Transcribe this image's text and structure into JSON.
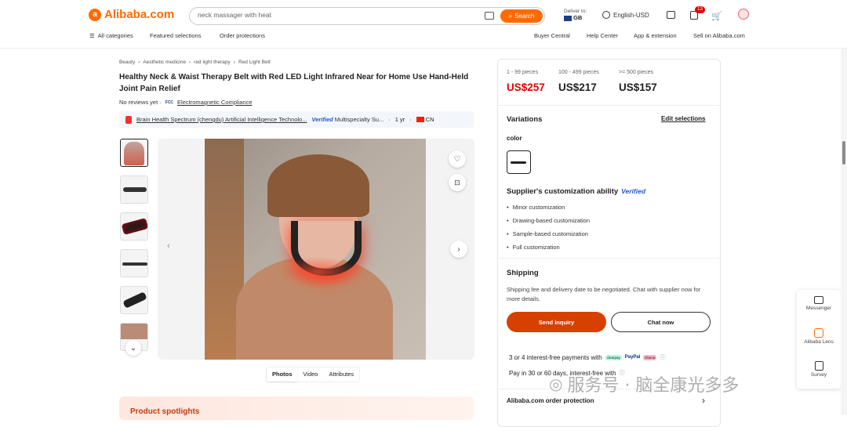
{
  "header": {
    "logo": "Alibaba.com",
    "search_value": "neck massager with heat",
    "search_button": "Search",
    "deliver_to_label": "Deliver to:",
    "deliver_to_country": "GB",
    "language": "English-USD",
    "cart_badge": "13",
    "nav_left": [
      "All categories",
      "Featured selections",
      "Order protections"
    ],
    "nav_right": [
      "Buyer Central",
      "Help Center",
      "App & extension",
      "Sell on Alibaba.com"
    ]
  },
  "breadcrumb": [
    "Beauty",
    "Aesthetic medicine",
    "red light therapy",
    "Red Light Belt"
  ],
  "product": {
    "title": "Healthy Neck & Waist Therapy Belt with Red LED Light Infrared Near for Home Use Hand-Held Joint Pain Relief",
    "reviews": "No reviews yet ·",
    "fcc_badge": "FCC",
    "compliance": "Electromagnetic Compliance"
  },
  "supplier": {
    "name": "Brain Health Spectrum (chengdu) Artificial Intelligence Technolo...",
    "verified": "Verified",
    "type": "Multispecialty Su...",
    "years": "1 yr",
    "country": "CN"
  },
  "media_tabs": [
    "Photos",
    "Video",
    "Attributes"
  ],
  "spotlight": "Product spotlights",
  "pricing": {
    "tiers": [
      {
        "range": "1 - 99 pieces",
        "price": "US$257"
      },
      {
        "range": "100 - 499 pieces",
        "price": "US$217"
      },
      {
        "range": ">= 500 pieces",
        "price": "US$157"
      }
    ]
  },
  "variations": {
    "heading": "Variations",
    "edit": "Edit selections",
    "color_label": "color"
  },
  "customization": {
    "heading": "Supplier's customization ability",
    "verified": "Verified",
    "items": [
      "Minor customization",
      "Drawing-based customization",
      "Sample-based customization",
      "Full customization"
    ]
  },
  "shipping": {
    "heading": "Shipping",
    "text": "Shipping fee and delivery date to be negotiated. Chat with supplier now for more details."
  },
  "actions": {
    "send_inquiry": "Send inquiry",
    "chat_now": "Chat now"
  },
  "payments": {
    "interest_free": "3 or 4 interest-free payments with",
    "pay_later": "Pay in 30 or 60 days, interest-free with",
    "providers": [
      "clearpay",
      "PayPal",
      "Klarna"
    ]
  },
  "order_protection": "Alibaba.com order protection",
  "float_panel": [
    "Messenger",
    "Alibaba Lens",
    "Survey"
  ],
  "watermark": "服务号 · 脑全康光多多",
  "colors": {
    "accent": "#ff6a00",
    "price_red": "#e60000",
    "inquiry": "#d64000"
  }
}
